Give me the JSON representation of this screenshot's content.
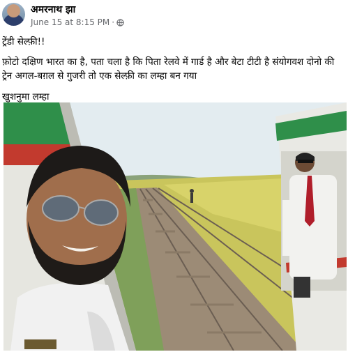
{
  "post": {
    "author_name": "अमरनाथ झा",
    "timestamp": "June 15 at 8:15 PM",
    "separator": "·",
    "privacy_icon": "globe-icon",
    "text_lines": [
      "ट्रेंडी सेल्फ़ी!!",
      "फ़ोटो दक्षिण भारत का है, पता चला है कि पिता रेलवे में गार्ड है और बेटा टीटी है संयोगवश दोनो की ट्रेन अगल-बग़ल से गुजरी तो एक सेल्फ़ी का लम्हा बन गया",
      "खुशनुमा लम्हा"
    ]
  },
  "photo": {
    "description_icon": "selfie-photo",
    "colors": {
      "sky": "#dfe9ee",
      "field": "#c8c45a",
      "train_green": "#2f8f4a",
      "train_red": "#c23a2e",
      "train_white": "#e8e8e4"
    }
  }
}
